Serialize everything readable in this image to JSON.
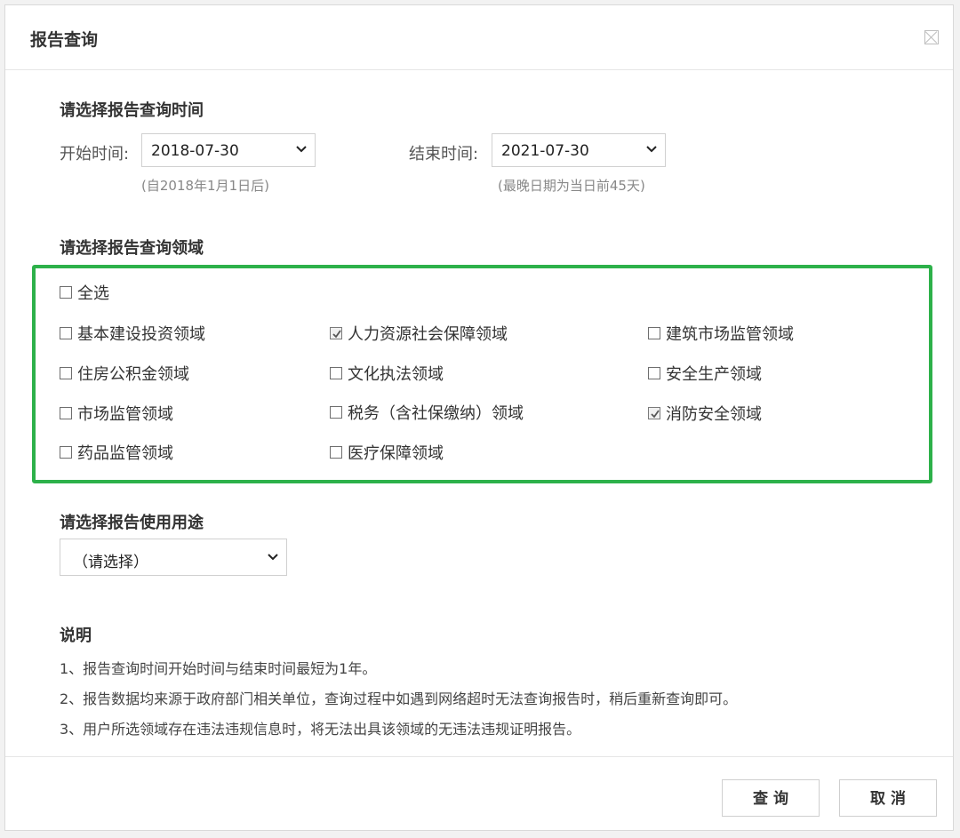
{
  "dialog": {
    "title": "报告查询",
    "close_icon": "close-icon"
  },
  "time_section": {
    "heading": "请选择报告查询时间",
    "start_label": "开始时间:",
    "start_value": "2018-07-30",
    "start_hint": "(自2018年1月1日后)",
    "end_label": "结束时间:",
    "end_value": "2021-07-30",
    "end_hint": "(最晚日期为当日前45天)"
  },
  "domain_section": {
    "heading": "请选择报告查询领域",
    "select_all": {
      "label": "全选",
      "checked": false
    },
    "items": [
      {
        "label": "基本建设投资领域",
        "checked": false
      },
      {
        "label": "人力资源社会保障领域",
        "checked": true
      },
      {
        "label": "建筑市场监管领域",
        "checked": false
      },
      {
        "label": "住房公积金领域",
        "checked": false
      },
      {
        "label": "文化执法领域",
        "checked": false
      },
      {
        "label": "安全生产领域",
        "checked": false
      },
      {
        "label": "市场监管领域",
        "checked": false
      },
      {
        "label": "税务（含社保缴纳）领域",
        "checked": false
      },
      {
        "label": "消防安全领域",
        "checked": true
      },
      {
        "label": "药品监管领域",
        "checked": false
      },
      {
        "label": "医疗保障领域",
        "checked": false
      }
    ],
    "highlight_color": "#2db14a"
  },
  "purpose_section": {
    "heading": "请选择报告使用用途",
    "select_value": "（请选择）"
  },
  "notes": {
    "heading": "说明",
    "lines": [
      "1、报告查询时间开始时间与结束时间最短为1年。",
      "2、报告数据均来源于政府部门相关单位，查询过程中如遇到网络超时无法查询报告时，稍后重新查询即可。",
      "3、用户所选领域存在违法违规信息时，将无法出具该领域的无违法违规证明报告。"
    ]
  },
  "footer": {
    "query_label": "查询",
    "cancel_label": "取消"
  }
}
